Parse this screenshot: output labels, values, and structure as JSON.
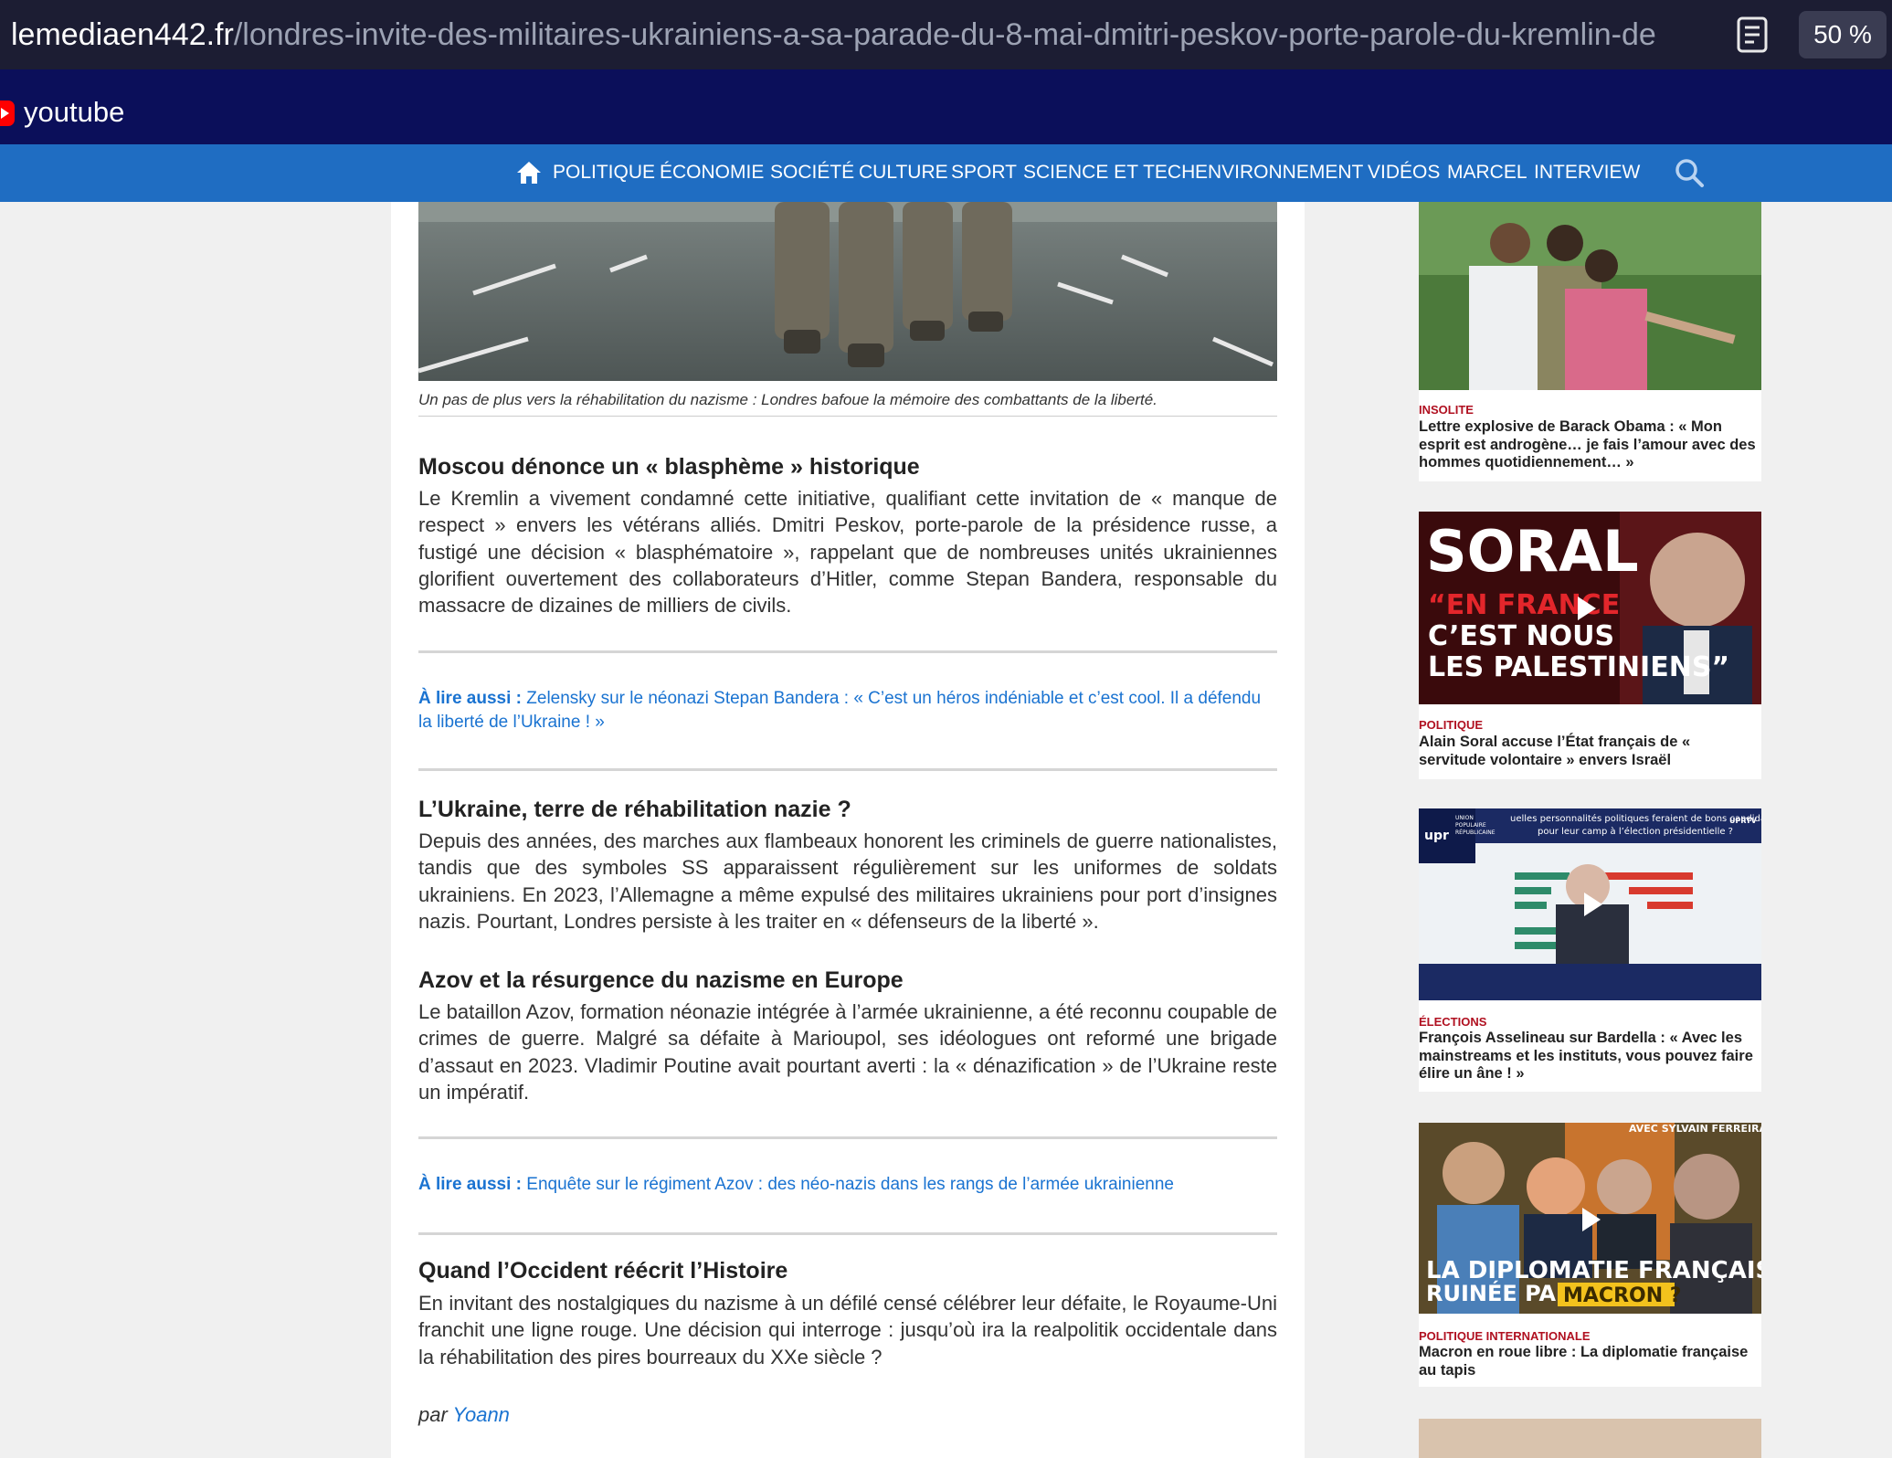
{
  "browser": {
    "url_domain": "lemediaen442.fr",
    "url_path": "/londres-invite-des-militaires-ukrainiens-a-sa-parade-du-8-mai-dmitri-peskov-porte-parole-du-kremlin-de",
    "zoom": "50 %",
    "bookmark_label": "youtube"
  },
  "nav": {
    "items": [
      "POLITIQUE",
      "ÉCONOMIE",
      "SOCIÉTÉ",
      "CULTURE",
      "SPORT",
      "SCIENCE ET TECH",
      "ENVIRONNEMENT",
      "VIDÉOS",
      "MARCEL",
      "INTERVIEW"
    ]
  },
  "article": {
    "caption": "Un pas de plus vers la réhabilitation du nazisme : Londres bafoue la mémoire des combattants de la liberté.",
    "sections": [
      {
        "heading": "Moscou dénonce un « blasphème » historique",
        "body": "Le Kremlin a vivement condamné cette initiative, qualifiant cette invitation de « manque de respect » envers les vétérans alliés. Dmitri Peskov, porte-parole de la présidence russe, a fustigé une décision « blasphématoire », rappelant que de nombreuses unités ukrainiennes glorifient ouvertement des collaborateurs d’Hitler, comme Stepan Bandera, responsable du massacre de dizaines de milliers de civils."
      },
      {
        "heading": "L’Ukraine, terre de réhabilitation nazie ?",
        "body": "Depuis des années, des marches aux flambeaux honorent les criminels de guerre nationalistes, tandis que des symboles SS apparaissent régulièrement sur les uniformes de soldats ukrainiens. En 2023, l’Allemagne a même expulsé des militaires ukrainiens pour port d’insignes nazis. Pourtant, Londres persiste à les traiter en « défenseurs de la liberté »."
      },
      {
        "heading": "Azov et la résurgence du nazisme en Europe",
        "body": "Le bataillon Azov, formation néonazie intégrée à l’armée ukrainienne, a été reconnu coupable de crimes de guerre. Malgré sa défaite à Marioupol, ses idéologues ont reformé une brigade d’assaut en 2023. Vladimir Poutine avait pourtant averti : la « dénazification » de l’Ukraine reste un impératif."
      },
      {
        "heading": "Quand l’Occident réécrit l’Histoire",
        "body": "En invitant des nostalgiques du nazisme à un défilé censé célébrer leur défaite, le Royaume-Uni franchit une ligne rouge. Une décision qui interroge : jusqu’où ira la realpolitik occidentale dans la réhabilitation des pires bourreaux du XXe siècle ?"
      }
    ],
    "read_also_label": "À lire aussi :",
    "read_also": [
      "Zelensky sur le néonazi Stepan Bandera : « C’est un héros indéniable et c’est cool. Il a défendu la liberté de l’Ukraine ! »",
      "Enquête sur le régiment Azov : des néo-nazis dans les rangs de l’armée ukrainienne"
    ],
    "byline_prefix": "par",
    "author": "Yoann"
  },
  "sidebar": {
    "cards": [
      {
        "category": "INSOLITE",
        "title": "Lettre explosive de Barack Obama : « Mon esprit est androgène… je fais l’amour avec des hommes quotidiennement… »"
      },
      {
        "category": "POLITIQUE",
        "title": "Alain Soral accuse l’État français de « servitude volontaire » envers Israël",
        "thumb_text": [
          "SORAL",
          "“EN FRANCE",
          "C’EST NOUS",
          "LES PALESTINIENS”"
        ]
      },
      {
        "category": "ÉLECTIONS",
        "title": "François Asselineau sur Bardella : « Avec les mainstreams et les instituts, vous pouvez faire élire un âne ! »",
        "thumb_text": [
          "uelles personnalités politiques feraient de bons candidats",
          "pour leur camp à l’élection présidentielle ?",
          "UNION",
          "POPULAIRE",
          "RÉPUBLICAINE",
          "upr",
          "UPRTV"
        ]
      },
      {
        "category": "POLITIQUE INTERNATIONALE",
        "title": "Macron en roue libre : La diplomatie française au tapis",
        "thumb_text": [
          "AVEC SYLVAIN FERREIRA",
          "LA DIPLOMATIE FRANÇAISE",
          "RUINÉE PAR",
          "MACRON ?"
        ]
      }
    ]
  },
  "colors": {
    "url_bar": "#1c1d33",
    "bookmarks_bar": "#0b0f5a",
    "site_nav": "#1f6dc2",
    "link": "#1a73d1",
    "category_red": "#b01020"
  }
}
